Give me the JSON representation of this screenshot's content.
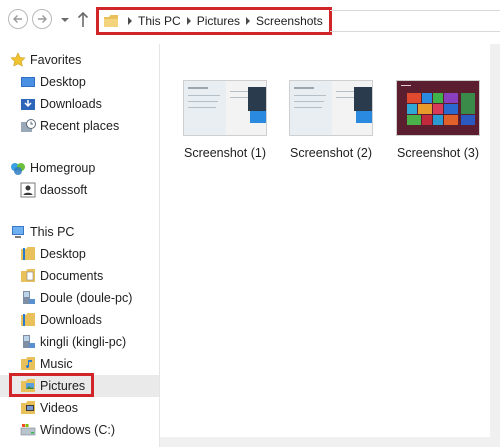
{
  "address": {
    "crumbs": [
      "This PC",
      "Pictures",
      "Screenshots"
    ]
  },
  "sidebar": {
    "items": [
      {
        "label": "Favorites",
        "icon": "star-icon"
      },
      {
        "label": "Desktop",
        "icon": "desktop-icon"
      },
      {
        "label": "Downloads",
        "icon": "downloads-icon"
      },
      {
        "label": "Recent places",
        "icon": "recent-places-icon"
      },
      {
        "label": "Homegroup",
        "icon": "homegroup-icon"
      },
      {
        "label": "daossoft",
        "icon": "user-icon"
      },
      {
        "label": "This PC",
        "icon": "computer-icon"
      },
      {
        "label": "Desktop",
        "icon": "folder-icon"
      },
      {
        "label": "Documents",
        "icon": "documents-icon"
      },
      {
        "label": "Doule (doule-pc)",
        "icon": "network-computer-icon"
      },
      {
        "label": "Downloads",
        "icon": "folder-icon"
      },
      {
        "label": "kingli (kingli-pc)",
        "icon": "network-computer-icon"
      },
      {
        "label": "Music",
        "icon": "music-icon"
      },
      {
        "label": "Pictures",
        "icon": "pictures-icon"
      },
      {
        "label": "Videos",
        "icon": "videos-icon"
      },
      {
        "label": "Windows (C:)",
        "icon": "drive-icon"
      }
    ],
    "selected": "Pictures"
  },
  "files": [
    {
      "name": "Screenshot (1)"
    },
    {
      "name": "Screenshot (2)"
    },
    {
      "name": "Screenshot (3)"
    }
  ],
  "colors": {
    "highlight_box": "#d0262a",
    "selected_bg": "#eaeaea",
    "folder_yellow": "#e8c15a"
  }
}
